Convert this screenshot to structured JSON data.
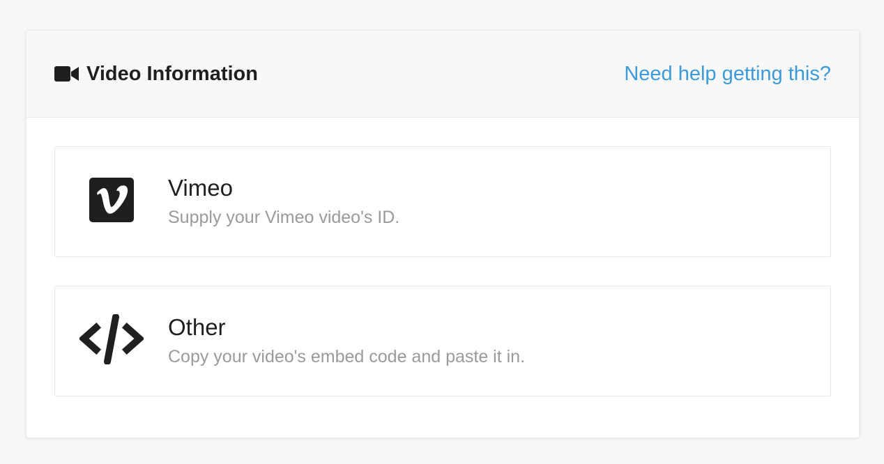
{
  "header": {
    "icon": "video-camera-icon",
    "title": "Video Information",
    "help_link": "Need help getting this?"
  },
  "options": [
    {
      "icon": "vimeo-icon",
      "title": "Vimeo",
      "description": "Supply your Vimeo video's ID."
    },
    {
      "icon": "code-icon",
      "title": "Other",
      "description": "Copy your video's embed code and paste it in."
    }
  ],
  "colors": {
    "link": "#3d9ad9",
    "title_text": "#1f1f1f",
    "description_text": "#9a9a9a",
    "header_bg": "#f8f8f8"
  }
}
